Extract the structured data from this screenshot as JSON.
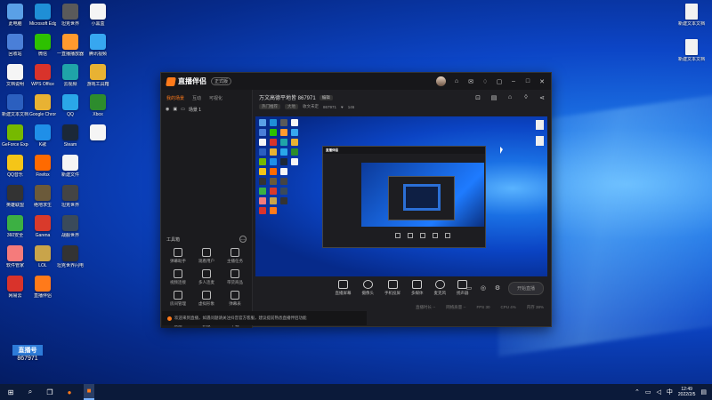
{
  "desktop": {
    "icons": [
      {
        "label": "此电脑",
        "color": "#5aa0e6"
      },
      {
        "label": "Microsoft Edge",
        "color": "#1f8fd6"
      },
      {
        "label": "坦克世界",
        "color": "#5a5a5a"
      },
      {
        "label": "小黑盒",
        "color": "#f5f5f5"
      },
      {
        "label": "回收站",
        "color": "#4a7fd8"
      },
      {
        "label": "微信",
        "color": "#2dc100"
      },
      {
        "label": "一直播播放器",
        "color": "#ff9a2e"
      },
      {
        "label": "腾讯视频",
        "color": "#37a7f0"
      },
      {
        "label": "文档说明",
        "color": "#f5f5f5"
      },
      {
        "label": "WPS Office",
        "color": "#d9332b"
      },
      {
        "label": "云视频",
        "color": "#1fa4a8"
      },
      {
        "label": "游戏工具箱",
        "color": "#e8b233"
      },
      {
        "label": "新建文本文档",
        "color": "#2b5fbf"
      },
      {
        "label": "Google Chrome",
        "color": "#e8b233"
      },
      {
        "label": "QQ",
        "color": "#2aa7e8"
      },
      {
        "label": "Xbox",
        "color": "#2d8c2d"
      },
      {
        "label": "GeForce Experience",
        "color": "#76b900"
      },
      {
        "label": "K歌",
        "color": "#1f8fe8"
      },
      {
        "label": "Steam",
        "color": "#1b2838"
      },
      {
        "label": "",
        "color": "#f5f5f5"
      },
      {
        "label": "QQ音乐",
        "color": "#f5c518"
      },
      {
        "label": "Firefox",
        "color": "#ff6a00"
      },
      {
        "label": "新建文件",
        "color": "#f5f5f5"
      },
      {
        "label": "",
        "color": "transparent"
      },
      {
        "label": "英雄联盟",
        "color": "#333"
      },
      {
        "label": "绝地求生",
        "color": "#6b5a3a"
      },
      {
        "label": "坦克世界",
        "color": "#444"
      },
      {
        "label": "",
        "color": "transparent"
      },
      {
        "label": "360安全",
        "color": "#3cb043"
      },
      {
        "label": "Garena",
        "color": "#d93a2b"
      },
      {
        "label": "战舰世界",
        "color": "#3a4a5a"
      },
      {
        "label": "",
        "color": "transparent"
      },
      {
        "label": "软件管家",
        "color": "#f57b7b"
      },
      {
        "label": "LOL",
        "color": "#c9a44a"
      },
      {
        "label": "坦克世界闪电战",
        "color": "#333"
      },
      {
        "label": "",
        "color": "transparent"
      },
      {
        "label": "网易云",
        "color": "#d9332b"
      },
      {
        "label": "直播伴侣",
        "color": "#ff7a1a"
      },
      {
        "label": "",
        "color": "transparent"
      },
      {
        "label": "",
        "color": "transparent"
      }
    ],
    "right_icons": [
      {
        "label": "新建文本文档"
      },
      {
        "label": "新建文本文档 (2)"
      }
    ]
  },
  "window": {
    "app_name": "直播伴侣",
    "version_badge": "正式版",
    "title_icons": [
      "avatar",
      "shirt-icon",
      "message-icon",
      "bell-icon",
      "lock-icon",
      "minimize-icon",
      "maximize-icon",
      "close-icon"
    ],
    "left_tabs": [
      {
        "label": "我的场景",
        "active": true
      },
      {
        "label": "互动",
        "active": false
      },
      {
        "label": "可视化",
        "active": false
      }
    ],
    "scene_item": "场景 1",
    "toolbox_label": "工具箱",
    "tools": [
      {
        "label": "弹幕助手"
      },
      {
        "label": "观看用户"
      },
      {
        "label": "主播任务"
      },
      {
        "label": "视频连接"
      },
      {
        "label": "多人连麦"
      },
      {
        "label": "带货商品"
      },
      {
        "label": "房间管理"
      },
      {
        "label": "虚拟形象"
      },
      {
        "label": "弹幕表"
      },
      {
        "label": "数据"
      },
      {
        "label": "新版"
      },
      {
        "label": "下载"
      }
    ],
    "notice": "欢迎来到直播，如遇问题请关注抖音官方客服，建议提前熟悉直播伴侣功能",
    "room_title": "万文高德平地皆 867971",
    "edit_label": "编辑",
    "room_tag": "热门推荐",
    "room_tag2": "大地",
    "room_category": "收文未定",
    "room_id": "867971",
    "room_likes": "146",
    "controls": [
      {
        "label": "直播屏幕",
        "name": "screen-share-button"
      },
      {
        "label": "摄像头",
        "name": "camera-button"
      },
      {
        "label": "手机投屏",
        "name": "phone-cast-button"
      },
      {
        "label": "多媒体",
        "name": "media-button"
      },
      {
        "label": "麦克风",
        "name": "microphone-button"
      },
      {
        "label": "扬声器",
        "name": "speaker-button"
      }
    ],
    "start_label": "开始直播",
    "status": [
      "直播时长 --",
      "网络质量 --",
      "FPS 30",
      "CPU 4%",
      "内存 38%"
    ]
  },
  "overlay": {
    "line1": "直播号",
    "line2": "867971"
  },
  "taskbar": {
    "time": "12:49",
    "date": "2022/2/5",
    "lang": "中"
  }
}
